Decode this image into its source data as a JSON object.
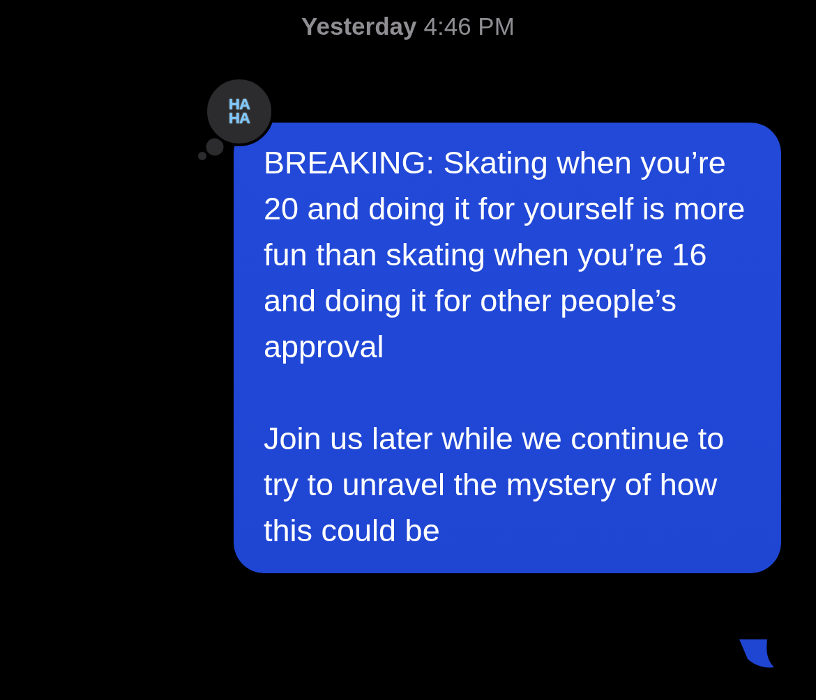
{
  "timestamp": {
    "day": "Yesterday",
    "time": "4:46 PM"
  },
  "reaction": {
    "lines": [
      "HA",
      "HA"
    ]
  },
  "message": {
    "paragraphs": [
      "BREAKING: Skating when you’re 20 and doing it for yourself is more fun than skating when you’re 16 and doing it for other people’s approval",
      "Join us later while we continue to try to unravel the mystery of how this could be"
    ]
  }
}
